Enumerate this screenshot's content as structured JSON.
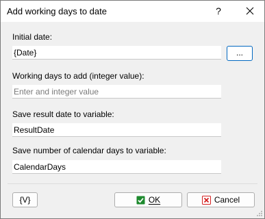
{
  "window": {
    "title": "Add working days to date",
    "help_label": "?"
  },
  "fields": {
    "initial_date": {
      "label": "Initial date:",
      "value": "{Date}"
    },
    "browse_button": "...",
    "working_days": {
      "label": "Working days to add (integer value):",
      "placeholder": "Enter and integer value"
    },
    "result_variable": {
      "label": "Save result date to variable:",
      "value": "ResultDate"
    },
    "calendar_days_variable": {
      "label": "Save number of calendar days to variable:",
      "value": "CalendarDays"
    }
  },
  "buttons": {
    "variables_label": "{V}",
    "ok_label": "OK",
    "cancel_label": "Cancel"
  },
  "icons": {
    "ok": "check-icon",
    "cancel": "x-icon",
    "close": "close-icon"
  },
  "colors": {
    "ok_icon": "#1e8a2e",
    "cancel_icon": "#d42020",
    "focus_border": "#0067c0"
  }
}
